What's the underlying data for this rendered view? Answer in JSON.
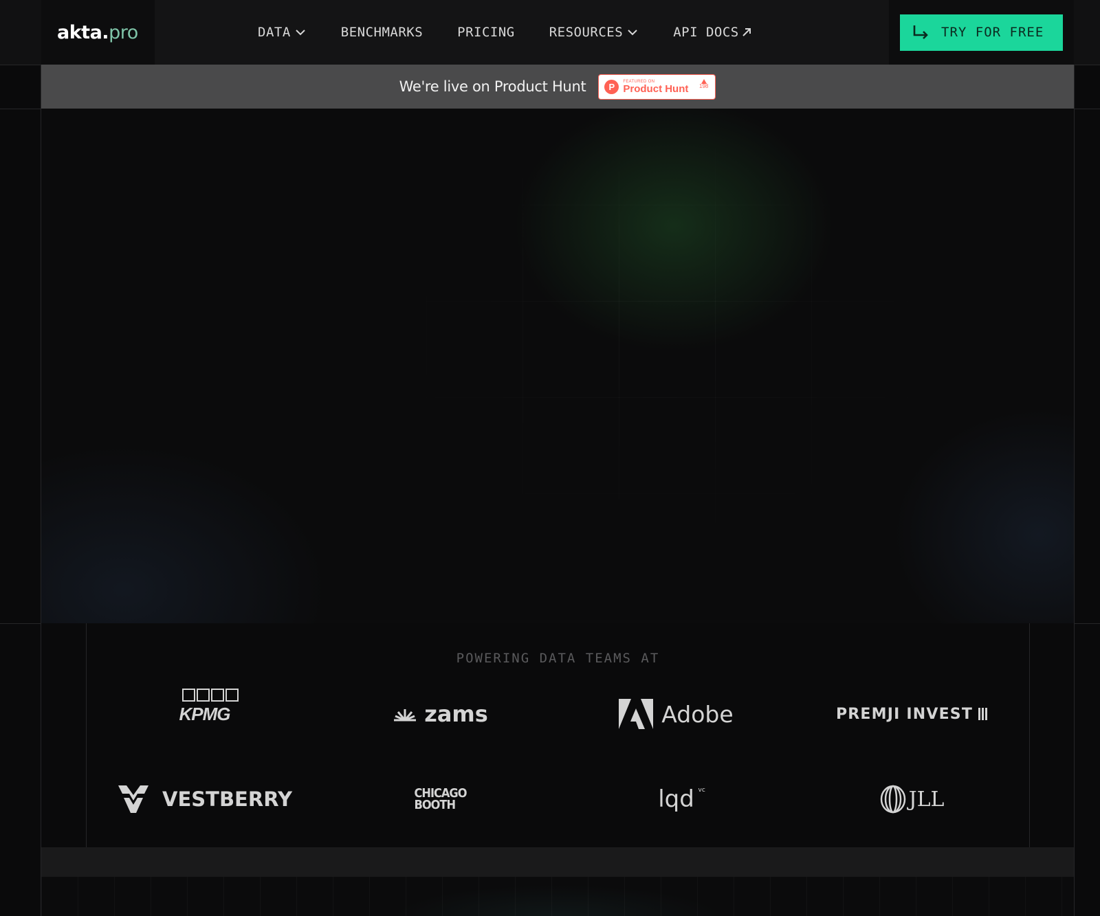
{
  "nav": {
    "logo_main": "akta.",
    "logo_accent": "pro",
    "items": [
      {
        "label": "DATA",
        "has_dropdown": true
      },
      {
        "label": "BENCHMARKS",
        "has_dropdown": false
      },
      {
        "label": "PRICING",
        "has_dropdown": false
      },
      {
        "label": "RESOURCES",
        "has_dropdown": true
      },
      {
        "label": "API DOCS",
        "external": true
      }
    ],
    "cta_label": "TRY FOR FREE"
  },
  "banner": {
    "text": "We're live on Product Hunt",
    "badge_small": "FEATURED ON",
    "badge_big": "Product Hunt",
    "badge_votes": "198"
  },
  "logos": {
    "heading": "POWERING DATA TEAMS AT",
    "items": [
      "KPMG",
      "zams",
      "Adobe",
      "PREMJI INVEST",
      "VESTBERRY",
      "CHICAGO BOOTH",
      "lqd",
      "JLL"
    ],
    "lqd_sup": "vc",
    "chicago_line1": "CHICAGO",
    "chicago_line2": "BOOTH"
  },
  "colors": {
    "accent": "#1bd69b",
    "logo_accent": "#7fc4a8",
    "product_hunt": "#ff6154",
    "banner_bg": "#4a4a4b"
  }
}
